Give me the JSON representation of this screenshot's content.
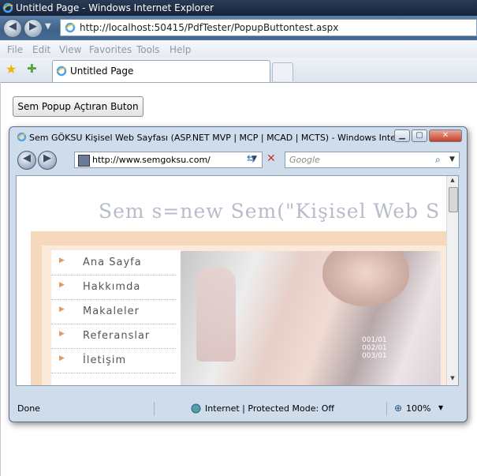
{
  "browser": {
    "title": "Untitled Page - Windows Internet Explorer",
    "url": "http://localhost:50415/PdfTester/PopupButtontest.aspx",
    "menu": [
      "File",
      "Edit",
      "View",
      "Favorites",
      "Tools",
      "Help"
    ],
    "tab_label": "Untitled Page"
  },
  "page": {
    "button_label": "Sem Popup  Açtıran Buton"
  },
  "popup": {
    "title": "Sem GÖKSU Kişisel Web Sayfası (ASP.NET MVP | MCP | MCAD | MCTS) - Windows Internet...",
    "url": "http://www.semgoksu.com/",
    "search_placeholder": "Google",
    "banner_text": "Sem s=new Sem(\"Kişisel Web S",
    "nav_items": [
      "Ana Sayfa",
      "Hakkımda",
      "Makaleler",
      "Referanslar",
      "İletişim"
    ],
    "photo_overlay": [
      "001/01",
      "002/01",
      "003/01"
    ],
    "status": {
      "left": "Done",
      "zone": "Internet | Protected Mode: Off",
      "zoom": "100%"
    }
  },
  "colors": {
    "titlebar": "#1b2a42",
    "accent_orange": "#e49a5c",
    "banner_text": "#b7bccb"
  }
}
